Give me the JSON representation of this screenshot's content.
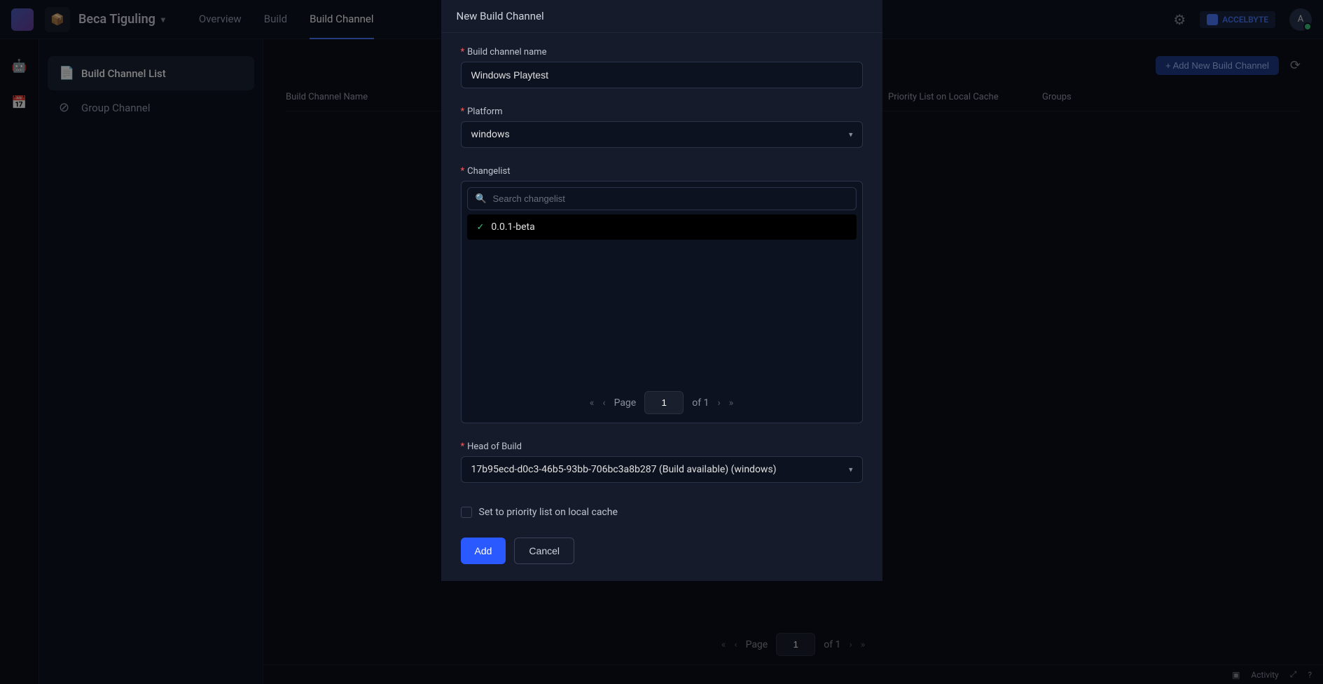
{
  "topbar": {
    "project_name": "Beca Tiguling",
    "nav": {
      "overview": "Overview",
      "build": "Build",
      "buildchannel": "Build Channel"
    },
    "brand": "ACCELBYTE",
    "avatar_initial": "A"
  },
  "sidebar": {
    "items": [
      {
        "label": "Build Channel List",
        "icon": "📄"
      },
      {
        "label": "Group Channel",
        "icon": "⊘"
      }
    ]
  },
  "main": {
    "add_button": "+ Add New Build Channel",
    "columns": {
      "name": "Build Channel Name",
      "priority": "Priority List on Local Cache",
      "groups": "Groups"
    },
    "pagination": {
      "page_label": "Page",
      "page_value": "1",
      "of_label": "of 1"
    }
  },
  "modal": {
    "title": "New Build Channel",
    "labels": {
      "channel_name": "Build channel name",
      "platform": "Platform",
      "changelist": "Changelist",
      "head_of_build": "Head of Build"
    },
    "channel_name_value": "Windows Playtest",
    "platform_value": "windows",
    "changelist_search_placeholder": "Search changelist",
    "changelist_options": [
      {
        "label": "0.0.1-beta",
        "selected": true
      }
    ],
    "changelist_pagination": {
      "page_label": "Page",
      "page_value": "1",
      "of_label": "of 1"
    },
    "head_of_build_value": "17b95ecd-d0c3-46b5-93bb-706bc3a8b287 (Build available) (windows)",
    "priority_checkbox_label": "Set to priority list on local cache",
    "priority_checked": false,
    "actions": {
      "add": "Add",
      "cancel": "Cancel"
    }
  },
  "activity": {
    "label": "Activity"
  }
}
